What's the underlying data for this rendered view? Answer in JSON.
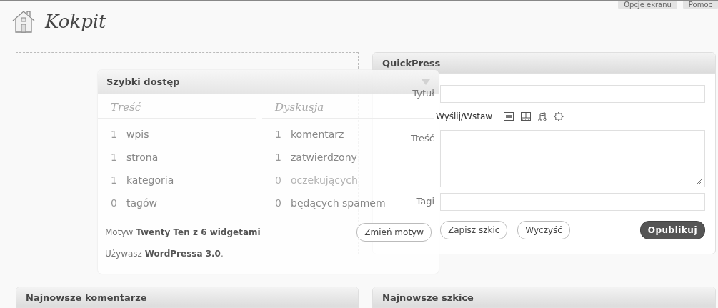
{
  "screen_meta": [
    {
      "label": "Opcje ekranu"
    },
    {
      "label": "Pomoc"
    }
  ],
  "page_title": "Kokpit",
  "quickpress": {
    "title": "QuickPress",
    "fields": [
      {
        "kind": "input",
        "label": "Tytuł"
      },
      {
        "kind": "media",
        "label": "Wyślij/Wstaw"
      },
      {
        "kind": "textarea",
        "label": "Treść"
      },
      {
        "kind": "input",
        "label": "Tagi"
      }
    ],
    "buttons": [
      {
        "label": "Zapisz szkic",
        "primary": false
      },
      {
        "label": "Wyczyść",
        "primary": false
      },
      {
        "label": "Opublikuj",
        "primary": true
      }
    ]
  },
  "dragged_widget": {
    "title": "Szybki dostęp",
    "content": {
      "heading": "Treść",
      "rows": [
        {
          "count": "1",
          "label": "wpis",
          "dimmed": false
        },
        {
          "count": "1",
          "label": "strona",
          "dimmed": false
        },
        {
          "count": "1",
          "label": "kategoria",
          "dimmed": false
        },
        {
          "count": "0",
          "label": "tagów",
          "dimmed": false
        }
      ]
    },
    "discussion": {
      "heading": "Dyskusja",
      "rows": [
        {
          "count": "1",
          "label": "komentarz",
          "dimmed": false
        },
        {
          "count": "1",
          "label": "zatwierdzony",
          "dimmed": false
        },
        {
          "count": "0",
          "label": "oczekujących",
          "dimmed": true
        },
        {
          "count": "0",
          "label": "będących spamem",
          "dimmed": false
        }
      ]
    },
    "theme_text": "Motyw **Twenty Ten z 6 widgetami**",
    "theme_button": "Zmień motyw",
    "version_text": "Używasz **WordPressa 3.0**."
  },
  "bottom_widgets": [
    {
      "title": "Najnowsze komentarze"
    },
    {
      "title": "Najnowsze szkice"
    }
  ]
}
